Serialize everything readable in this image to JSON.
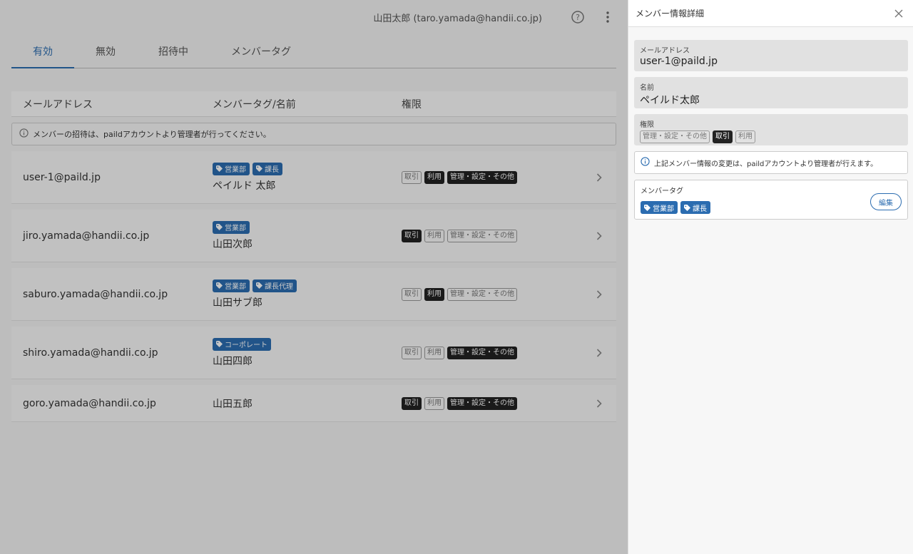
{
  "header": {
    "user_label": "山田太郎 (taro.yamada@handii.co.jp)"
  },
  "tabs": [
    {
      "label": "有効"
    },
    {
      "label": "無効"
    },
    {
      "label": "招待中"
    },
    {
      "label": "メンバータグ"
    }
  ],
  "table": {
    "columns": [
      "メールアドレス",
      "メンバータグ/名前",
      "権限"
    ],
    "notice": "メンバーの招待は、paildアカウントより管理者が行ってください。",
    "rows": [
      {
        "email": "user-1@paild.jp",
        "tags": [
          "営業部",
          "課長"
        ],
        "name": "ペイルド 太郎",
        "perms": [
          {
            "label": "取引",
            "on": false
          },
          {
            "label": "利用",
            "on": true
          },
          {
            "label": "管理・設定・その他",
            "on": true
          }
        ]
      },
      {
        "email": "jiro.yamada@handii.co.jp",
        "tags": [
          "営業部"
        ],
        "name": "山田次郎",
        "perms": [
          {
            "label": "取引",
            "on": true
          },
          {
            "label": "利用",
            "on": false
          },
          {
            "label": "管理・設定・その他",
            "on": false
          }
        ]
      },
      {
        "email": "saburo.yamada@handii.co.jp",
        "tags": [
          "営業部",
          "課長代理"
        ],
        "name": "山田サブ郎",
        "perms": [
          {
            "label": "取引",
            "on": false
          },
          {
            "label": "利用",
            "on": true
          },
          {
            "label": "管理・設定・その他",
            "on": false
          }
        ]
      },
      {
        "email": "shiro.yamada@handii.co.jp",
        "tags": [
          "コーポレート"
        ],
        "name": "山田四郎",
        "perms": [
          {
            "label": "取引",
            "on": false
          },
          {
            "label": "利用",
            "on": false
          },
          {
            "label": "管理・設定・その他",
            "on": true
          }
        ]
      },
      {
        "email": "goro.yamada@handii.co.jp",
        "tags": [],
        "name": "山田五郎",
        "perms": [
          {
            "label": "取引",
            "on": true
          },
          {
            "label": "利用",
            "on": false
          },
          {
            "label": "管理・設定・その他",
            "on": true
          }
        ]
      }
    ]
  },
  "panel": {
    "title": "メンバー情報詳細",
    "email_label": "メールアドレス",
    "email_value": "user-1@paild.jp",
    "name_label": "名前",
    "name_value": "ペイルド太郎",
    "perm_label": "権限",
    "perms": [
      {
        "label": "管理・設定・その他",
        "on": false
      },
      {
        "label": "取引",
        "on": true
      },
      {
        "label": "利用",
        "on": false
      }
    ],
    "notice": "上記メンバー情報の変更は、paildアカウントより管理者が行えます。",
    "tag_label": "メンバータグ",
    "tags": [
      "営業部",
      "課長"
    ],
    "edit_label": "編集"
  },
  "colors": {
    "accent": "#2b6cb0",
    "badge_on": "#222222"
  },
  "icons": [
    "help-icon",
    "more-vert-icon",
    "info-icon",
    "tag-icon",
    "chevron-right-icon",
    "close-icon"
  ]
}
